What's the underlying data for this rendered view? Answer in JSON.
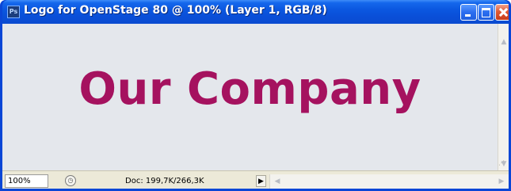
{
  "window": {
    "title": "Logo for OpenStage 80 @ 100% (Layer 1, RGB/8)",
    "app_icon_label": "Ps",
    "colors": {
      "titlebar": "#0a4fd8",
      "canvas": "#e4e7ec",
      "logo_text": "#a5125f",
      "close_button": "#e05a34"
    }
  },
  "canvas": {
    "logo_text": "Our Company"
  },
  "statusbar": {
    "zoom_value": "100%",
    "doc_info": "Doc: 199,7K/266,3K",
    "menu_arrow_icon": "triangle-right-icon"
  },
  "icons": {
    "minimize": "minimize-icon",
    "maximize": "maximize-icon",
    "close": "close-icon",
    "scroll_up": "chevron-up-icon",
    "scroll_down": "chevron-down-icon",
    "scroll_left": "chevron-left-icon",
    "scroll_right": "chevron-right-icon"
  }
}
